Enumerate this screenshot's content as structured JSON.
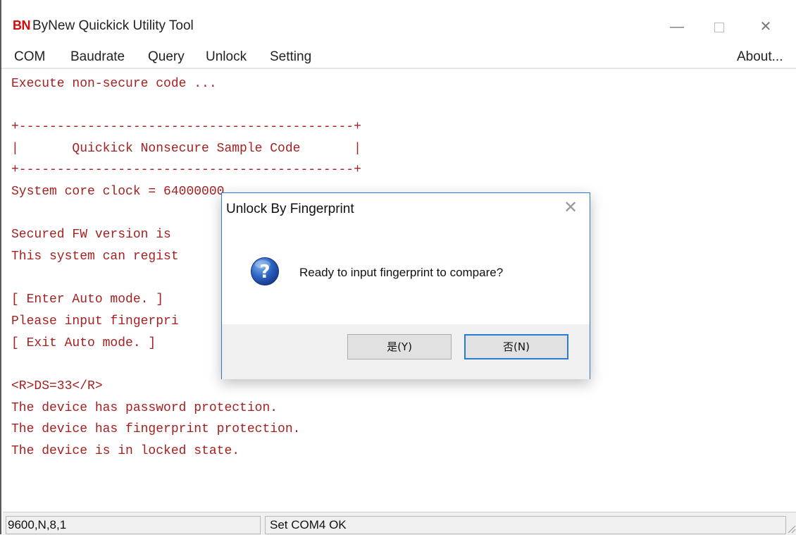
{
  "window": {
    "logo": "BN",
    "title": "ByNew Quickick Utility Tool",
    "controls": {
      "minimize": "—",
      "close": "✕"
    }
  },
  "menu": {
    "items": [
      "COM",
      "Baudrate",
      "Query",
      "Unlock",
      "Setting"
    ],
    "about": "About..."
  },
  "console": {
    "lines": [
      "Execute non-secure code ...",
      "",
      "+--------------------------------------------+",
      "|       Quickick Nonsecure Sample Code       |",
      "+--------------------------------------------+",
      "System core clock = 64000000",
      "",
      "Secured FW version is",
      "This system can regist",
      "",
      "[ Enter Auto mode. ]",
      "Please input fingerpri",
      "[ Exit Auto mode. ]",
      "",
      "<R>DS=33</R>",
      "The device has password protection.",
      "The device has fingerprint protection.",
      "The device is in locked state."
    ]
  },
  "status": {
    "serial_settings": "9600,N,8,1",
    "message": "Set COM4 OK"
  },
  "dialog": {
    "title": "Unlock By Fingerprint",
    "close": "✕",
    "message": "Ready to input fingerprint to compare?",
    "icon": "question-icon",
    "yes_label": "是(Y)",
    "no_label": "否(N)"
  },
  "colors": {
    "console_text": "#a52020",
    "logo": "#d20a0a",
    "accent": "#2d7bd1"
  }
}
